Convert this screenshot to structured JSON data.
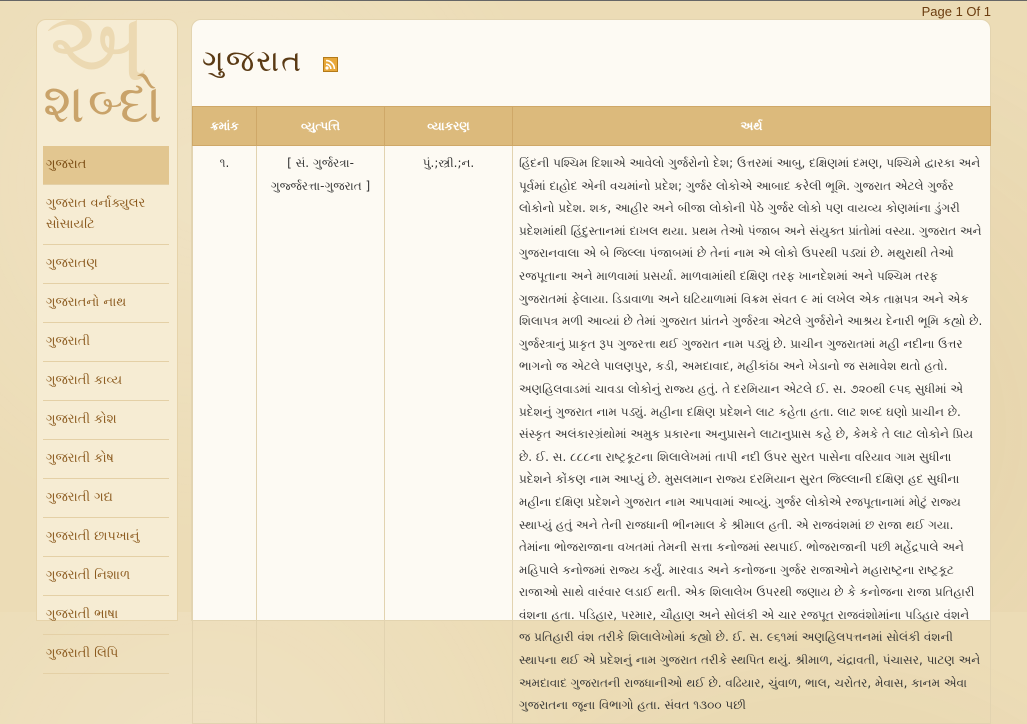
{
  "pager": {
    "label": "Page 1 Of 1"
  },
  "logo": {
    "back_letter": "અ",
    "word": "શબ્દો"
  },
  "sidebar": {
    "items": [
      {
        "label": "ગુજરાત",
        "active": true
      },
      {
        "label": "ગુજરાત વર્નાક્યુલર સોસાયટિ"
      },
      {
        "label": "ગુજરાતણ"
      },
      {
        "label": "ગુજરાતનો નાથ"
      },
      {
        "label": "ગુજરાતી"
      },
      {
        "label": "ગુજરાતી કાવ્ય"
      },
      {
        "label": "ગુજરાતી કોશ"
      },
      {
        "label": "ગુજરાતી કોષ"
      },
      {
        "label": "ગુજરાતી ગદ્ય"
      },
      {
        "label": "ગુજરાતી છાપખાનું"
      },
      {
        "label": "ગુજરાતી નિશાળ"
      },
      {
        "label": "ગુજરાતી ભાષા"
      },
      {
        "label": "ગુજરાતી લિપિ"
      }
    ]
  },
  "main": {
    "title": "ગુજરાત",
    "rss_icon": "rss-feed-icon",
    "table": {
      "headers": [
        "ક્રમાંક",
        "વ્યુત્પત્તિ",
        "વ્યાકરણ",
        "અર્થ"
      ],
      "rows": [
        {
          "num": "૧.",
          "etymology": "[ સં. ગુર્જરત્રા-ગુર્જ્જરત્તા-ગુજરાત ]",
          "grammar": "પું.;સ્ત્રી.;ન.",
          "meaning": "હિંદની પશ્ચિમ દિશાએ આવેલો ગુર્જરોનો દેશ; ઉત્તરમાં આબુ, દક્ષિણમાં દમણ, પશ્ચિમે દ્વારકા અને પૂર્વમાં દાહોદ એની વચમાંનો પ્રદેશ; ગુર્જર લોકોએ આબાદ કરેલી ભૂમિ. ગુજરાત એટલે ગુર્જર લોકોનો પ્રદેશ. શક, આહીર અને બીજા લોકોની પેઠે ગુર્જર લોકો પણ વાયવ્ય કોણમાંના ડુંગરી પ્રદેશમાંથી હિંદુસ્તાનમાં દાખલ થયા. પ્રથમ તેઓ પંજાબ અને સંયુક્ત પ્રાંતોમાં વસ્યા. ગુજરાત અને ગુજરાનવાલા એ બે જિલ્લા પંજાબમાં છે તેનાં નામ એ લોકો ઉપરથી પડ્યાં છે. મથુરાથી તેઓ રજપૂતાના અને માળવામાં પ્રસર્યા. માળવામાંથી દક્ષિણ તરફ ખાનદેશમાં અને પશ્ચિમ તરફ ગુજરાતમાં ફેલાયા. ડિડાવાળા અને ઘટિયાળામાં વિક્રમ સંવત ૯ માં લખેલ એક તામ્રપત્ર અને એક શિલાપત્ર મળી આવ્યાં છે તેમાં ગુજરાત પ્રાંતને ગુર્જરત્રા એટલે ગુર્જરોને આશ્રય દેનારી ભૂમિ કહ્યો છે. ગુર્જરત્રાનું પ્રાકૃત રૂપ ગુજરત્તા થઈ ગુજરાત નામ પડ્યું છે. પ્રાચીન ગુજરાતમાં મહી નદીના ઉત્તર ભાગનો જ એટલે પાલણપુર, કડી, અમદાવાદ, મહીકાંઠા અને ખેડાનો જ સમાવેશ થતો હતો. અણહિલવાડમાં ચાવડા લોકોનું રાજ્ય હતું. તે દરમિયાન એટલે ઈ. સ. ૭૨૦થી ૯૫૬ સુધીમાં એ પ્રદેશનું ગુજરાત નામ પડ્યું. મહીના દક્ષિણ પ્રદેશને લાટ કહેતા હતા. લાટ શબ્દ ઘણો પ્રાચીન છે. સંસ્કૃત અલંકારગ્રંથોમાં અમુક પ્રકારના અનુપ્રાસને લાટાનુપ્રાસ કહે છે, કેમકે તે લાટ લોકોને પ્રિય છે. ઈ. સ. ૮૮૮ના રાષ્ટ્રકૂટના શિલાલેખમાં તાપી નદી ઉપર સુરત પાસેના વરિયાવ ગામ સુધીના પ્રદેશને કોંકણ નામ આપ્યું છે. મુસલમાન રાજ્ય દરમિયાન સુરત જિલ્લાની દક્ષિણ હદ સુધીના મહીના દક્ષિણ પ્રદેશને ગુજરાત નામ આપવામાં આવ્યું. ગુર્જર લોકોએ રજપૂતાનામાં મોટું રાજ્ય સ્થાપ્યું હતું અને તેની રાજધાની ભીનમાલ કે શ્રીમાલ હતી. એ રાજવંશમાં છ રાજા થઈ ગયા. તેમાંના ભોજરાજાના વખતમાં તેમની સત્તા કનોજમાં સ્થપાઈ. ભોજરાજાની પછી મહેંદ્રપાલે અને મહિપાલે કનોજમાં રાજ્ય કર્યું. મારવાડ અને કનોજના ગુર્જર રાજાઓને મહારાષ્ટ્રના રાષ્ટ્રકૂટ રાજાઓ સાથે વારંવાર લડાઈ થતી. એક શિલાલેખ ઉપરથી જણાય છે કે કનોજના રાજા પ્રતિહારી વંશના હતા. પડિહાર, પરમાર, ચૌહાણ અને સોલંકી એ ચાર રજપૂત રાજવંશોમાંના પડિહાર વંશને જ પ્રતિહારી વંશ તરીકે શિલાલેખોમાં કહ્યો છે. ઈ. સ. ૯૬૧માં અણહિલપત્તનમાં સોલંકી વંશની સ્થાપના થઈ એ પ્રદેશનું નામ ગુજરાત તરીકે સ્થપિત થયું. શ્રીમાળ, ચંદ્રાવતી, પંચાસર, પાટણ અને અમદાવાદ ગુજરાતની રાજધાનીઓ થઈ છે. વઢિયાર, ચુંવાળ, ભાલ, ચરોતર, મેવાસ, કાનમ એવા ગુજરાતના જૂના વિભાગો હતા. સંવત ૧૩૦૦ પછી"
        }
      ]
    }
  }
}
